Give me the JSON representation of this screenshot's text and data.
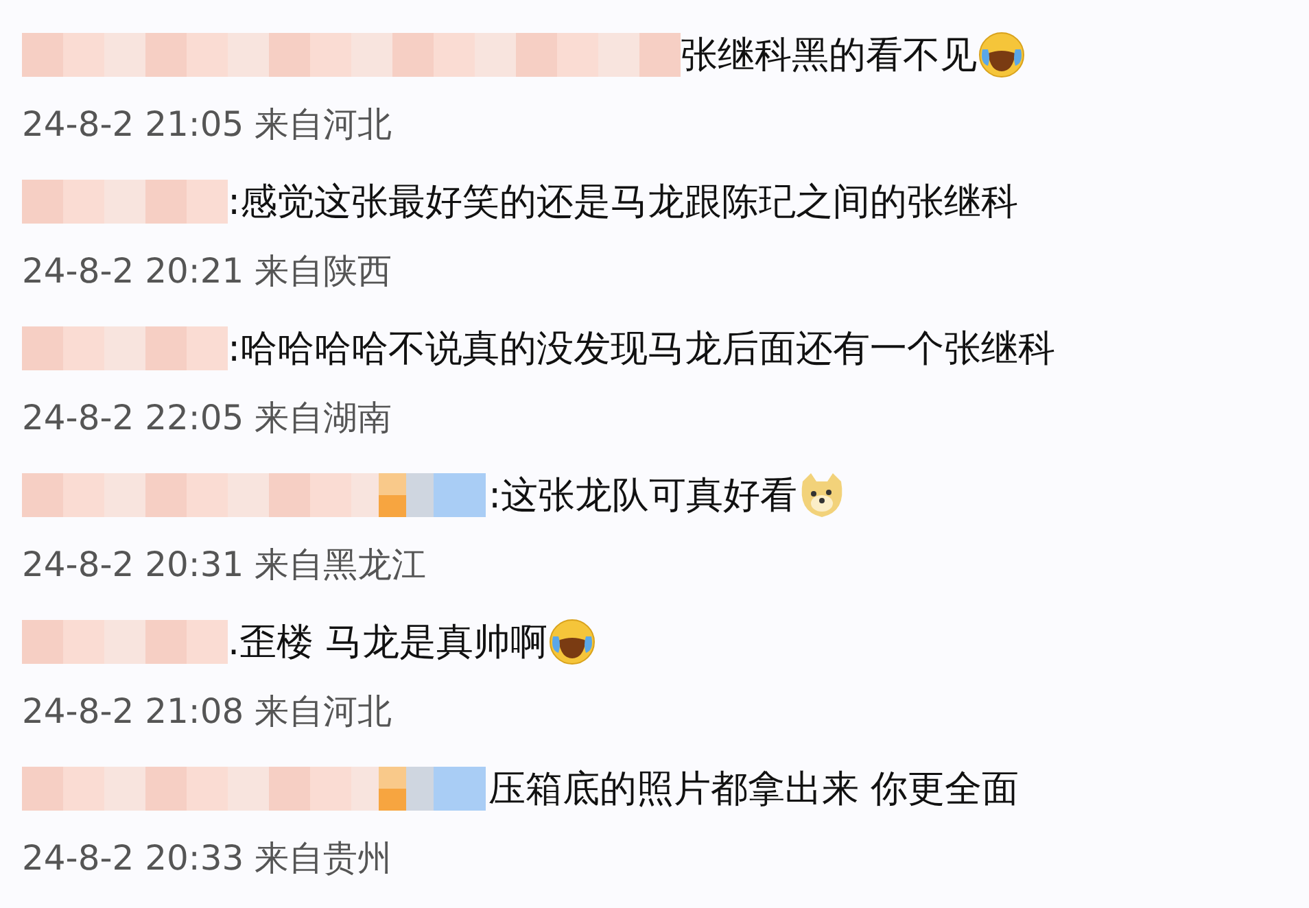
{
  "comments": [
    {
      "kind": "plain",
      "text": "张继科黑的看不见",
      "emoji": {
        "kind": "laugh-cry"
      },
      "meta": "24-8-2 21:05 来自河北"
    },
    {
      "kind": "short",
      "text": ":感觉这张最好笑的还是马龙跟陈玘之间的张继科",
      "meta": "24-8-2 20:21 来自陕西"
    },
    {
      "kind": "short",
      "text": ":哈哈哈哈不说真的没发现马龙后面还有一个张继科",
      "meta": "24-8-2 22:05 来自湖南"
    },
    {
      "kind": "tinted",
      "text": ":这张龙队可真好看",
      "emoji": {
        "kind": "doge"
      },
      "meta": "24-8-2 20:31 来自黑龙江"
    },
    {
      "kind": "short",
      "text": ".歪楼 马龙是真帅啊",
      "emoji": {
        "kind": "laugh-cry"
      },
      "meta": "24-8-2 21:08 来自河北"
    },
    {
      "kind": "tinted",
      "text": "压箱底的照片都拿出来 你更全面",
      "meta": "24-8-2 20:33 来自贵州"
    }
  ]
}
